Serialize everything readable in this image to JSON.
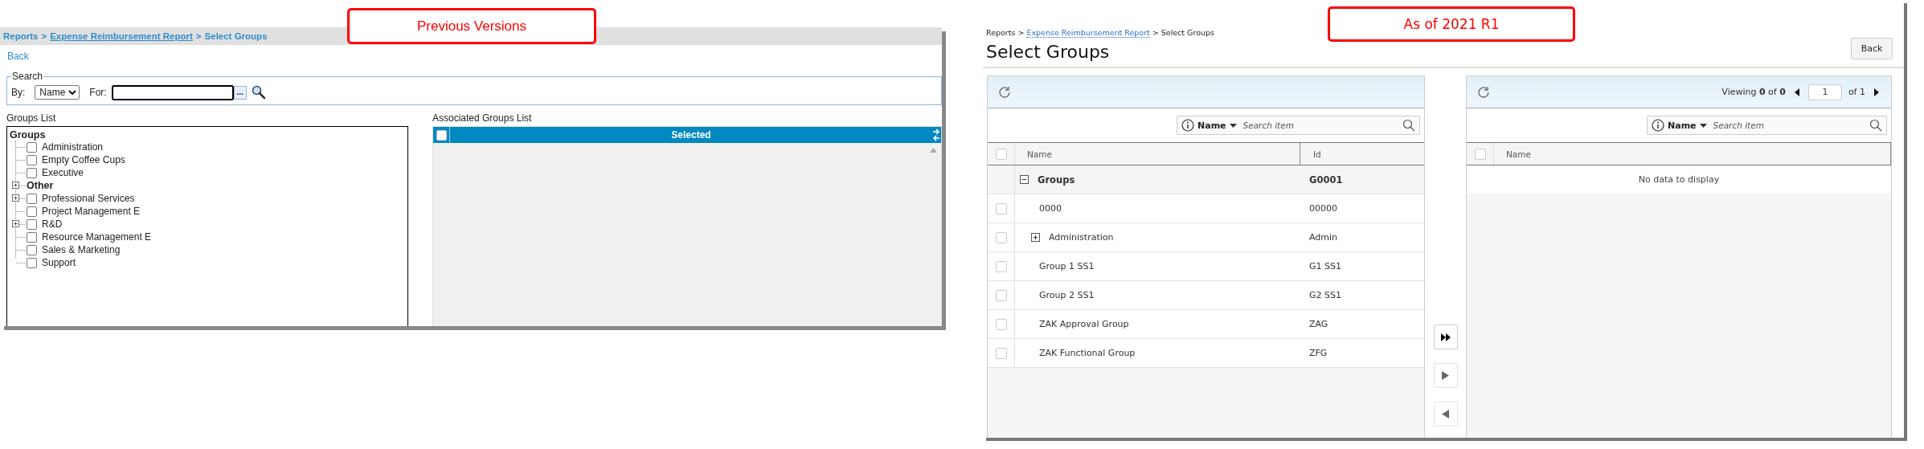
{
  "previous": {
    "callout": "Previous Versions",
    "breadcrumb": [
      {
        "text": "Reports",
        "link": false
      },
      {
        "text": "Expense Reimbursement Report",
        "link": true
      },
      {
        "text": "Select Groups",
        "link": false
      }
    ],
    "breadcrumb_separator": ">",
    "back_link": "Back",
    "search": {
      "legend": "Search",
      "by_label": "By:",
      "by_value": "Name",
      "for_label": "For:",
      "browse_button": "..."
    },
    "groups_list": {
      "label": "Groups List",
      "root": {
        "text": "Groups",
        "children": [
          {
            "text": "Administration",
            "kind": "item",
            "checked": false,
            "expandable": false
          },
          {
            "text": "Empty Coffee Cups",
            "kind": "item",
            "checked": false,
            "expandable": false
          },
          {
            "text": "Executive",
            "kind": "item",
            "checked": false,
            "expandable": false
          },
          {
            "text": "Other",
            "kind": "category",
            "expandable": true,
            "expanded": false
          },
          {
            "text": "Professional Services",
            "kind": "item",
            "checked": false,
            "expandable": true,
            "expanded": false
          },
          {
            "text": "Project Management E",
            "kind": "item",
            "checked": false,
            "expandable": false
          },
          {
            "text": "R&D",
            "kind": "item",
            "checked": false,
            "expandable": true,
            "expanded": false
          },
          {
            "text": "Resource Management E",
            "kind": "item",
            "checked": false,
            "expandable": false
          },
          {
            "text": "Sales & Marketing",
            "kind": "item",
            "checked": false,
            "expandable": false
          },
          {
            "text": "Support",
            "kind": "item",
            "checked": false,
            "expandable": false
          }
        ]
      }
    },
    "associated": {
      "label": "Associated Groups List",
      "header": "Selected",
      "select_all_checked": false
    }
  },
  "current": {
    "callout": "As of 2021 R1",
    "breadcrumb": [
      {
        "text": "Reports",
        "link": false
      },
      {
        "text": "Expense Reimbursement Report",
        "link": true
      },
      {
        "text": "Select Groups",
        "link": false
      }
    ],
    "breadcrumb_separator": ">",
    "title": "Select Groups",
    "back_button": "Back",
    "available": {
      "search": {
        "field": "Name",
        "placeholder": "Search item"
      },
      "columns": [
        "Name",
        "Id"
      ],
      "select_all_checked": false,
      "rows": [
        {
          "name": "Groups",
          "id": "G0001",
          "kind": "group",
          "expandable": true,
          "expanded": true,
          "children": [
            {
              "name": "0000",
              "id": "00000",
              "kind": "item",
              "checked": false,
              "expandable": false
            },
            {
              "name": "Administration",
              "id": "Admin",
              "kind": "item",
              "checked": false,
              "expandable": true,
              "expanded": false
            },
            {
              "name": "Group 1 SS1",
              "id": "G1 SS1",
              "kind": "item",
              "checked": false,
              "expandable": false
            },
            {
              "name": "Group 2 SS1",
              "id": "G2 SS1",
              "kind": "item",
              "checked": false,
              "expandable": false
            },
            {
              "name": "ZAK Approval Group",
              "id": "ZAG",
              "kind": "item",
              "checked": false,
              "expandable": false
            },
            {
              "name": "ZAK Functional Group",
              "id": "ZFG",
              "kind": "item",
              "checked": false,
              "expandable": false
            }
          ]
        }
      ]
    },
    "move_buttons": [
      {
        "kind": "move-all",
        "disabled": false
      },
      {
        "kind": "move-right",
        "disabled": true
      },
      {
        "kind": "move-left",
        "disabled": true
      }
    ],
    "selected": {
      "pager": {
        "viewing": "Viewing **0** of **0**",
        "page": "1",
        "of_pages": "of 1"
      },
      "search": {
        "field": "Name",
        "placeholder": "Search item"
      },
      "columns": [
        "Name"
      ],
      "select_all_checked": false,
      "empty_message": "No data to display"
    }
  }
}
